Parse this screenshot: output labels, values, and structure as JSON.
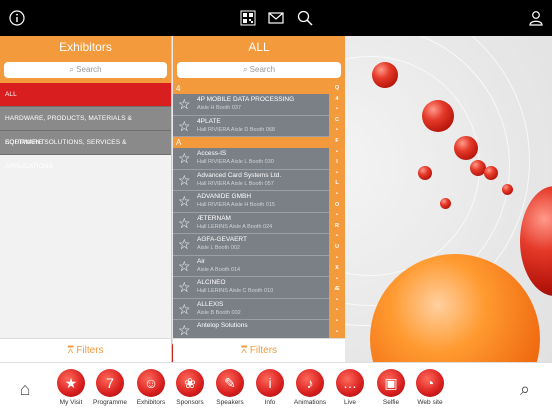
{
  "topbar": {
    "info_icon": "info-icon",
    "qr_icon": "qr-code-icon",
    "mail_icon": "mail-icon",
    "search_icon": "search-icon",
    "user_icon": "user-icon"
  },
  "left_pane": {
    "title": "Exhibitors",
    "search_placeholder": "Search",
    "categories": [
      {
        "label": "ALL",
        "active": true
      },
      {
        "label": "HARDWARE, PRODUCTS, MATERIALS & EQUIPMENT",
        "active": false
      },
      {
        "label": "SOFTWARE SOLUTIONS, SERVICES & APPLICATIONS",
        "active": false
      }
    ],
    "filters_label": "Filters"
  },
  "right_pane": {
    "title": "ALL",
    "search_placeholder": "Search",
    "sections": [
      {
        "header": "4",
        "items": [
          {
            "name": "4P MOBILE DATA PROCESSING",
            "location": "Aisle H Booth 037"
          },
          {
            "name": "4PLATE",
            "location": "Hall RIVIERA Aisle D Booth 068"
          }
        ]
      },
      {
        "header": "A",
        "items": [
          {
            "name": "Access-IS",
            "location": "Hall RIVIERA Aisle L Booth 030"
          },
          {
            "name": "Advanced Card Systems Ltd.",
            "location": "Hall RIVIERA Aisle L Booth 057"
          },
          {
            "name": "ADVANIDE GMBH",
            "location": "Hall RIVIERA Aisle H Booth 015"
          },
          {
            "name": "ÆTERNAM",
            "location": "Hall LERINS Aisle A Booth 024"
          },
          {
            "name": "AGFA-GEVAERT",
            "location": "Aisle L Booth 002"
          },
          {
            "name": "Air",
            "location": "Aisle A Booth 014"
          },
          {
            "name": "ALCINEO",
            "location": "Hall LERINS Aisle C Booth 010"
          },
          {
            "name": "ALLEXIS",
            "location": "Aisle B Booth 002"
          },
          {
            "name": "Antelop Solutions",
            "location": ""
          }
        ]
      }
    ],
    "index": [
      "Q",
      "4",
      "C",
      "F",
      "I",
      "L",
      "O",
      "R",
      "U",
      "X",
      "Æ"
    ],
    "filters_label": "Filters"
  },
  "bottom_tabs": [
    {
      "label": "",
      "icon": "home-icon"
    },
    {
      "label": "My Visit",
      "icon": "star-icon"
    },
    {
      "label": "Programme",
      "icon": "calendar-icon"
    },
    {
      "label": "Exhibitors",
      "icon": "person-icon"
    },
    {
      "label": "Sponsors",
      "icon": "handshake-icon"
    },
    {
      "label": "Speakers",
      "icon": "microphone-icon"
    },
    {
      "label": "Info",
      "icon": "info-icon"
    },
    {
      "label": "Animations",
      "icon": "megaphone-icon"
    },
    {
      "label": "Live",
      "icon": "chat-bubbles-icon"
    },
    {
      "label": "Selfie",
      "icon": "camera-icon"
    },
    {
      "label": "Web site",
      "icon": "rss-icon"
    },
    {
      "label": "",
      "icon": "search-icon"
    }
  ],
  "colors": {
    "accent": "#f39a3c",
    "active": "#d81e1e",
    "row_bg": "#7b8087"
  }
}
